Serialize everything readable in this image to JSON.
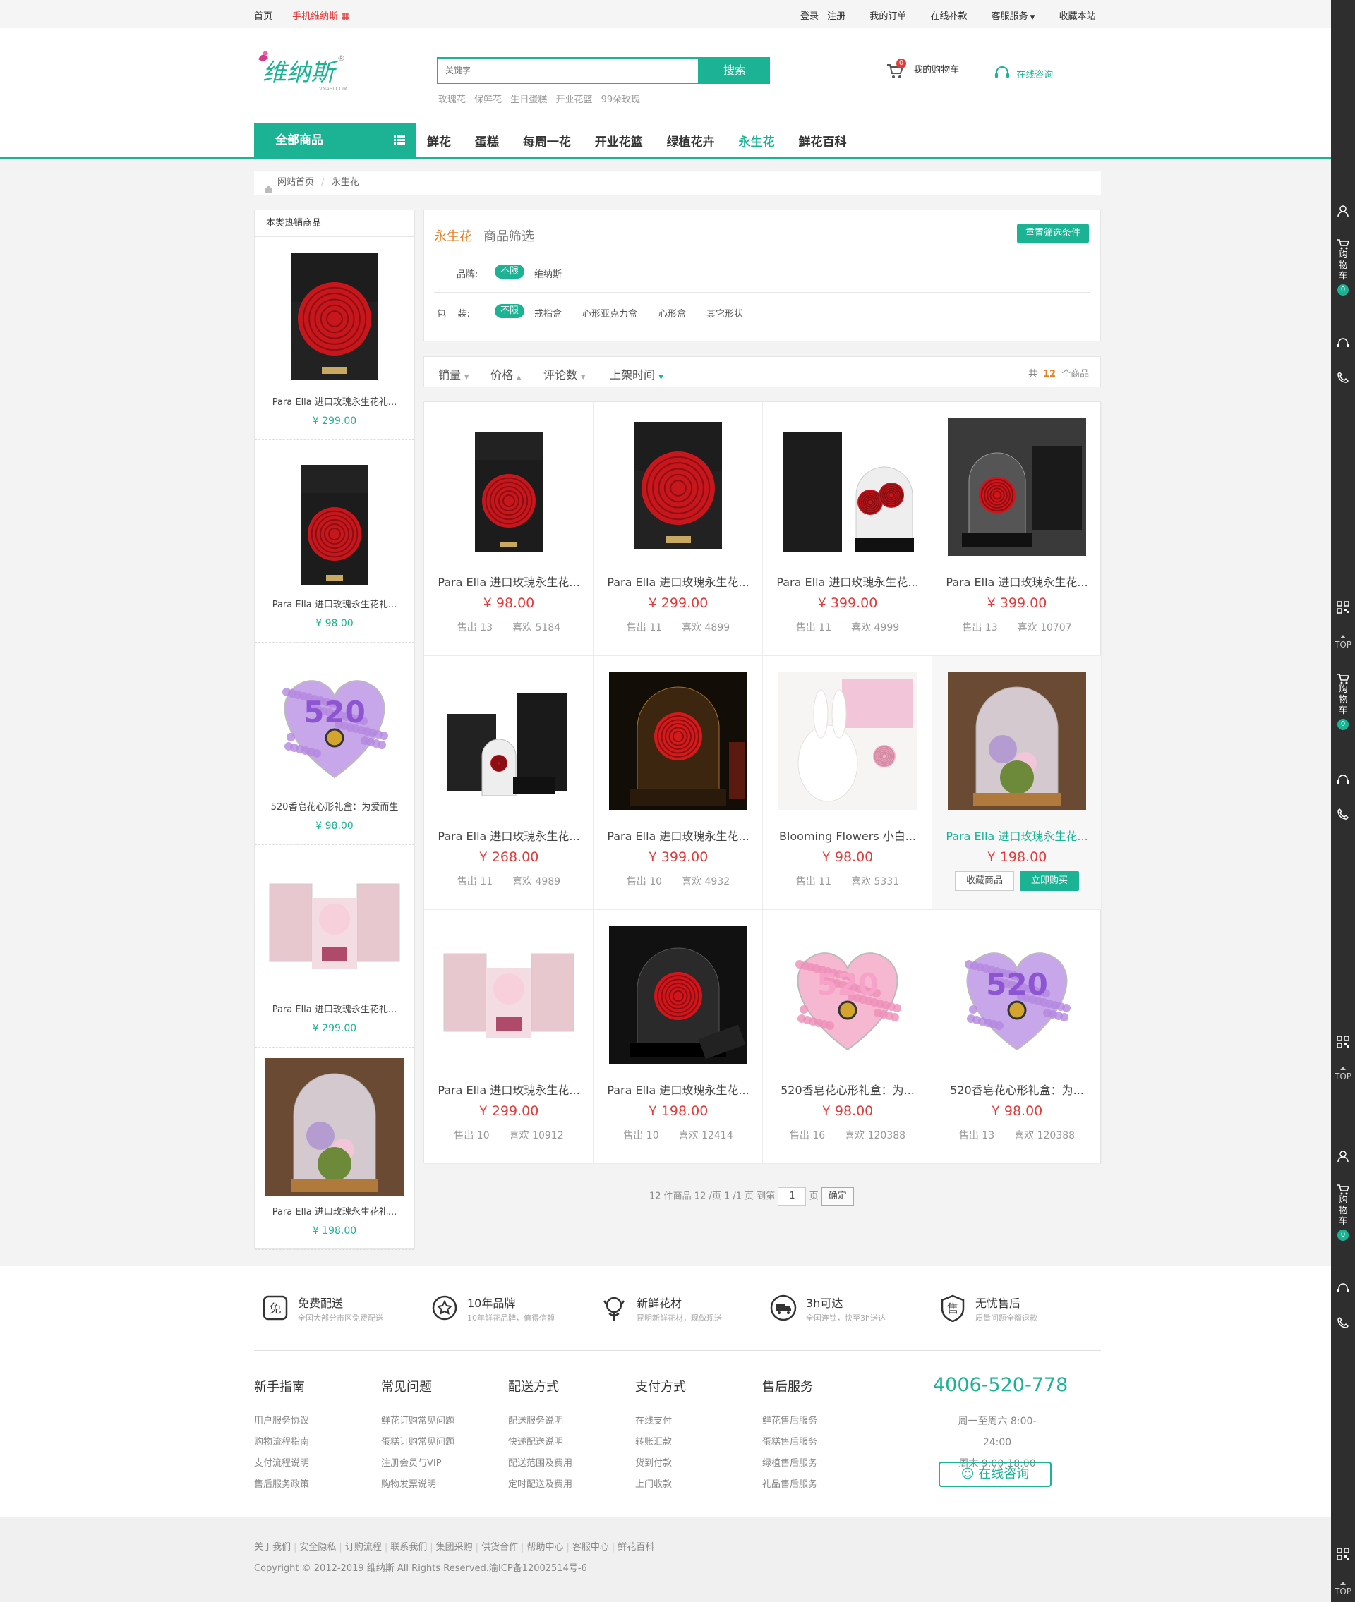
{
  "topbar": {
    "home": "首页",
    "mobile": "手机维纳斯",
    "links": [
      "登录",
      "注册",
      "我的订单",
      "在线补款",
      "客服服务",
      "收藏本站"
    ]
  },
  "header": {
    "logo_text": "维纳斯",
    "logo_sub": "VNASI.COM",
    "search_placeholder": "关键字",
    "search_button": "搜索",
    "hotwords": [
      "玫瑰花",
      "保鲜花",
      "生日蛋糕",
      "开业花篮",
      "99朵玫瑰"
    ],
    "cart_label": "我的购物车",
    "cart_count": "0",
    "consult_label": "在线咨询"
  },
  "nav": {
    "all_label": "全部商品",
    "items": [
      "鲜花",
      "蛋糕",
      "每周一花",
      "开业花篮",
      "绿植花卉",
      "永生花",
      "鲜花百科"
    ],
    "active": "永生花"
  },
  "breadcrumb": {
    "home": "网站首页",
    "sep": "/",
    "current": "永生花"
  },
  "sidebar": {
    "title": "本类热销商品",
    "items": [
      {
        "name": "Para Ella 进口玫瑰永生花礼...",
        "price": "¥ 299.00",
        "img": "redbox-open"
      },
      {
        "name": "Para Ella 进口玫瑰永生花礼...",
        "price": "¥ 98.00",
        "img": "redbox-tall"
      },
      {
        "name": "520香皂花心形礼盒：为爱而生",
        "price": "¥ 98.00",
        "img": "heart-purple"
      },
      {
        "name": "Para Ella 进口玫瑰永生花礼...",
        "price": "¥ 299.00",
        "img": "pink-box"
      },
      {
        "name": "Para Ella 进口玫瑰永生花礼...",
        "price": "¥ 198.00",
        "img": "dome-purple"
      }
    ]
  },
  "filter": {
    "title": "永生花",
    "subtitle": "商品筛选",
    "reset": "重置筛选条件",
    "brand_label": "品牌:",
    "brand_active": "不限",
    "brand_options": [
      "维纳斯"
    ],
    "pack_label": "包    装:",
    "pack_active": "不限",
    "pack_options": [
      "戒指盒",
      "心形亚克力盒",
      "心形盒",
      "其它形状"
    ]
  },
  "sort": {
    "options": [
      "销量",
      "价格",
      "评论数",
      "上架时间"
    ],
    "total_prefix": "共",
    "total": "12",
    "total_suffix": "个商品"
  },
  "products": [
    {
      "name": "Para Ella 进口玫瑰永生花...",
      "price": "¥ 98.00",
      "sold": "售出 13",
      "likes": "喜欢 5184",
      "img": "redbox-tall"
    },
    {
      "name": "Para Ella 进口玫瑰永生花...",
      "price": "¥ 299.00",
      "sold": "售出 11",
      "likes": "喜欢 4899",
      "img": "redbox-open"
    },
    {
      "name": "Para Ella 进口玫瑰永生花...",
      "price": "¥ 399.00",
      "sold": "售出 11",
      "likes": "喜欢 4999",
      "img": "box-dome"
    },
    {
      "name": "Para Ella 进口玫瑰永生花...",
      "price": "¥ 399.00",
      "sold": "售出 13",
      "likes": "喜欢 10707",
      "img": "dome-red"
    },
    {
      "name": "Para Ella 进口玫瑰永生花...",
      "price": "¥ 268.00",
      "sold": "售出 11",
      "likes": "喜欢 4989",
      "img": "bag-set"
    },
    {
      "name": "Para Ella 进口玫瑰永生花...",
      "price": "¥ 399.00",
      "sold": "售出 10",
      "likes": "喜欢 4932",
      "img": "dome-light"
    },
    {
      "name": "Blooming Flowers 小白...",
      "price": "¥ 98.00",
      "sold": "售出 11",
      "likes": "喜欢 5331",
      "img": "bunny"
    },
    {
      "name": "Para Ella 进口玫瑰永生花...",
      "price": "¥ 198.00",
      "fav": "收藏商品",
      "buy": "立即购买",
      "img": "dome-purple"
    },
    {
      "name": "Para Ella 进口玫瑰永生花...",
      "price": "¥ 299.00",
      "sold": "售出 10",
      "likes": "喜欢 10912",
      "img": "pink-box"
    },
    {
      "name": "Para Ella 进口玫瑰永生花...",
      "price": "¥ 198.00",
      "sold": "售出 10",
      "likes": "喜欢 12414",
      "img": "dome-dark"
    },
    {
      "name": "520香皂花心形礼盒：为...",
      "price": "¥ 98.00",
      "sold": "售出 16",
      "likes": "喜欢 120388",
      "img": "heart-pink"
    },
    {
      "name": "520香皂花心形礼盒：为...",
      "price": "¥ 98.00",
      "sold": "售出 13",
      "likes": "喜欢 120388",
      "img": "heart-purple"
    }
  ],
  "pager": {
    "text": "12 件商品 12 /页 1 /1 页 到第",
    "page": "1",
    "unit": "页",
    "ok": "确定"
  },
  "services": [
    {
      "title": "免费配送",
      "desc": "全国大部分市区免费配送",
      "icon": "free-icon",
      "glyph": "免"
    },
    {
      "title": "10年品牌",
      "desc": "10年鲜花品牌，值得信赖",
      "icon": "brand-icon"
    },
    {
      "title": "新鲜花材",
      "desc": "昆明新鲜花材，现做现送",
      "icon": "flower-icon"
    },
    {
      "title": "3h可达",
      "desc": "全国连锁，快至3h送达",
      "icon": "truck-icon"
    },
    {
      "title": "无忧售后",
      "desc": "质量问题全额退款",
      "icon": "shield-icon",
      "glyph": "售"
    }
  ],
  "footer_cols": [
    {
      "title": "新手指南",
      "links": [
        "用户服务协议",
        "购物流程指南",
        "支付流程说明",
        "售后服务政策"
      ]
    },
    {
      "title": "常见问题",
      "links": [
        "鲜花订购常见问题",
        "蛋糕订购常见问题",
        "注册会员与VIP",
        "购物发票说明"
      ]
    },
    {
      "title": "配送方式",
      "links": [
        "配送服务说明",
        "快递配送说明",
        "配送范围及费用",
        "定时配送及费用"
      ]
    },
    {
      "title": "支付方式",
      "links": [
        "在线支付",
        "转账汇款",
        "货到付款",
        "上门收款"
      ]
    },
    {
      "title": "售后服务",
      "links": [
        "鲜花售后服务",
        "蛋糕售后服务",
        "绿植售后服务",
        "礼品售后服务"
      ]
    }
  ],
  "contact": {
    "hotline": "4006-520-778",
    "hours1": "周一至周六 8:00-24:00",
    "hours2": "周末 9:00-18:00",
    "online": "在线咨询"
  },
  "bottom": {
    "links": [
      "关于我们",
      "安全隐私",
      "订购流程",
      "联系我们",
      "集团采购",
      "供货合作",
      "帮助中心",
      "客服中心",
      "鲜花百科"
    ],
    "copyright": "Copyright © 2012-2019 维纳斯 All Rights Reserved.渝ICP备12002514号-6"
  },
  "rightbar": {
    "cart_label": "购物车",
    "cart_count": "0",
    "top_label": "TOP"
  },
  "colors": {
    "accent": "#1cb394",
    "price": "#e23b3b",
    "orange": "#e67e22"
  }
}
